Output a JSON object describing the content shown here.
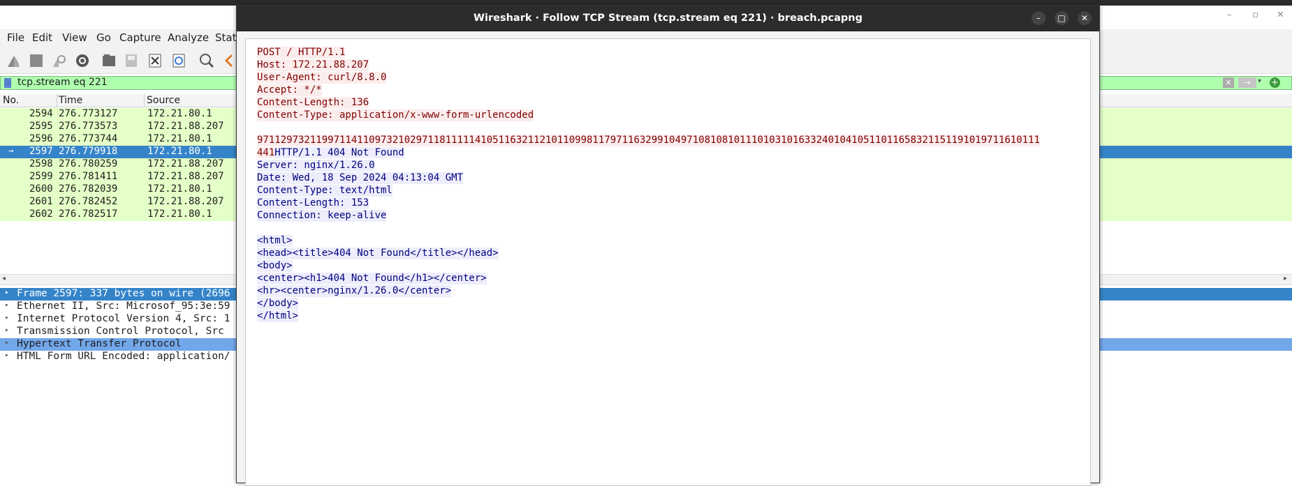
{
  "main": {
    "menu": [
      {
        "label": "File"
      },
      {
        "label": "Edit"
      },
      {
        "label": "View"
      },
      {
        "label": "Go"
      },
      {
        "label": "Capture"
      },
      {
        "label": "Analyze"
      },
      {
        "label": "Stati"
      }
    ],
    "filter": "tcp.stream eq 221",
    "columns": {
      "no": "No.",
      "time": "Time",
      "source": "Source"
    },
    "packets": [
      {
        "no": "2594",
        "time": "276.773127",
        "source": "172.21.80.1"
      },
      {
        "no": "2595",
        "time": "276.773573",
        "source": "172.21.88.207"
      },
      {
        "no": "2596",
        "time": "276.773744",
        "source": "172.21.80.1"
      },
      {
        "no": "2597",
        "time": "276.779918",
        "source": "172.21.80.1"
      },
      {
        "no": "2598",
        "time": "276.780259",
        "source": "172.21.88.207"
      },
      {
        "no": "2599",
        "time": "276.781411",
        "source": "172.21.88.207"
      },
      {
        "no": "2600",
        "time": "276.782039",
        "source": "172.21.80.1"
      },
      {
        "no": "2601",
        "time": "276.782452",
        "source": "172.21.88.207"
      },
      {
        "no": "2602",
        "time": "276.782517",
        "source": "172.21.80.1"
      }
    ],
    "details": [
      "Frame 2597: 337 bytes on wire (2696",
      "Ethernet II, Src: Microsof_95:3e:59",
      "Internet Protocol Version 4, Src: 1",
      "Transmission Control Protocol, Src",
      "Hypertext Transfer Protocol",
      "HTML Form URL Encoded: application/"
    ],
    "colors": {
      "selected": "#3584c9",
      "green": "#e4ffc7",
      "filter": "#afffaf"
    }
  },
  "dialog": {
    "title": "Wireshark · Follow TCP Stream (tcp.stream eq 221) · breach.pcapng",
    "client_lines": [
      "POST / HTTP/1.1",
      "Host: 172.21.88.207",
      "User-Agent: curl/8.8.0",
      "Accept: */*",
      "Content-Length: 136",
      "Content-Type: application/x-www-form-urlencoded",
      "",
      "9711297321199711411097321029711811111410511632112101109981179711632991049710810810111010310163324010410511011658321151191019711610111",
      "441"
    ],
    "server_first": "HTTP/1.1 404 Not Found",
    "server_lines": [
      "Server: nginx/1.26.0",
      "Date: Wed, 18 Sep 2024 04:13:04 GMT",
      "Content-Type: text/html",
      "Content-Length: 153",
      "Connection: keep-alive",
      "",
      "<html>",
      "<head><title>404 Not Found</title></head>",
      "<body>",
      "<center><h1>404 Not Found</h1></center>",
      "<hr><center>nginx/1.26.0</center>",
      "</body>",
      "</html>"
    ],
    "colors": {
      "client": "#7f0000",
      "client_bg": "#fbeded",
      "server": "#00007f",
      "server_bg": "#ededfb"
    }
  }
}
